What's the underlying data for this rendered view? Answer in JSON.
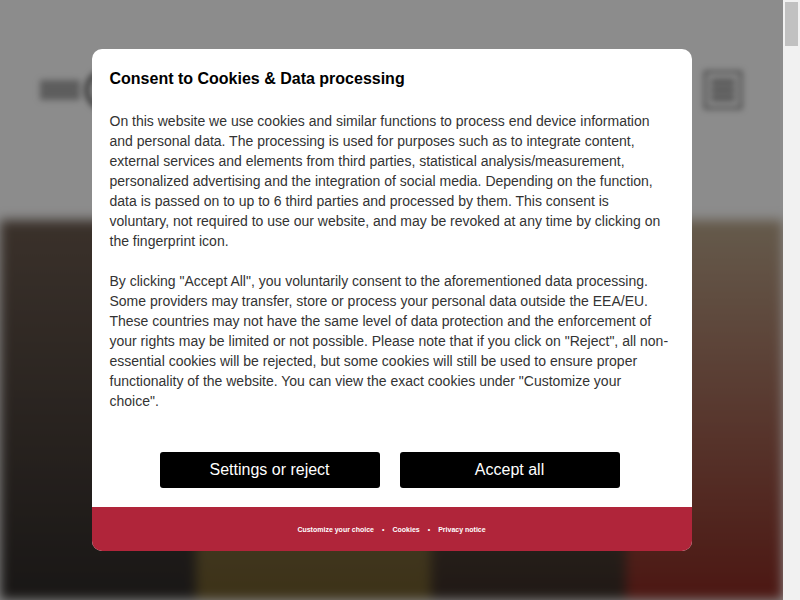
{
  "dialog": {
    "title": "Consent to Cookies & Data processing",
    "paragraphs": [
      "On this website we use cookies and similar functions to process end device information and personal data. The processing is used for purposes such as to integrate content, external services and elements from third parties, statistical analysis/measurement, personalized advertising and the integration of social media. Depending on the function, data is passed on to up to 6 third parties and processed by them. This consent is voluntary, not required to use our website, and may be revoked at any time by clicking on the fingerprint icon.",
      "By clicking \"Accept All\", you voluntarily consent to the aforementioned data processing. Some providers may transfer, store or process your personal data outside the EEA/EU. These countries may not have the same level of data protection and the enforcement of your rights may be limited or not possible. Please note that if you click on \"Reject\", all non-essential cookies will be rejected, but some cookies will still be used to ensure proper functionality of the website. You can view the exact cookies under \"Customize your choice\"."
    ],
    "buttons": [
      "Settings or reject",
      "Accept all"
    ]
  },
  "footer": {
    "links": [
      "Customize your choice",
      "Cookies",
      "Privacy notice"
    ],
    "separator": "•"
  }
}
